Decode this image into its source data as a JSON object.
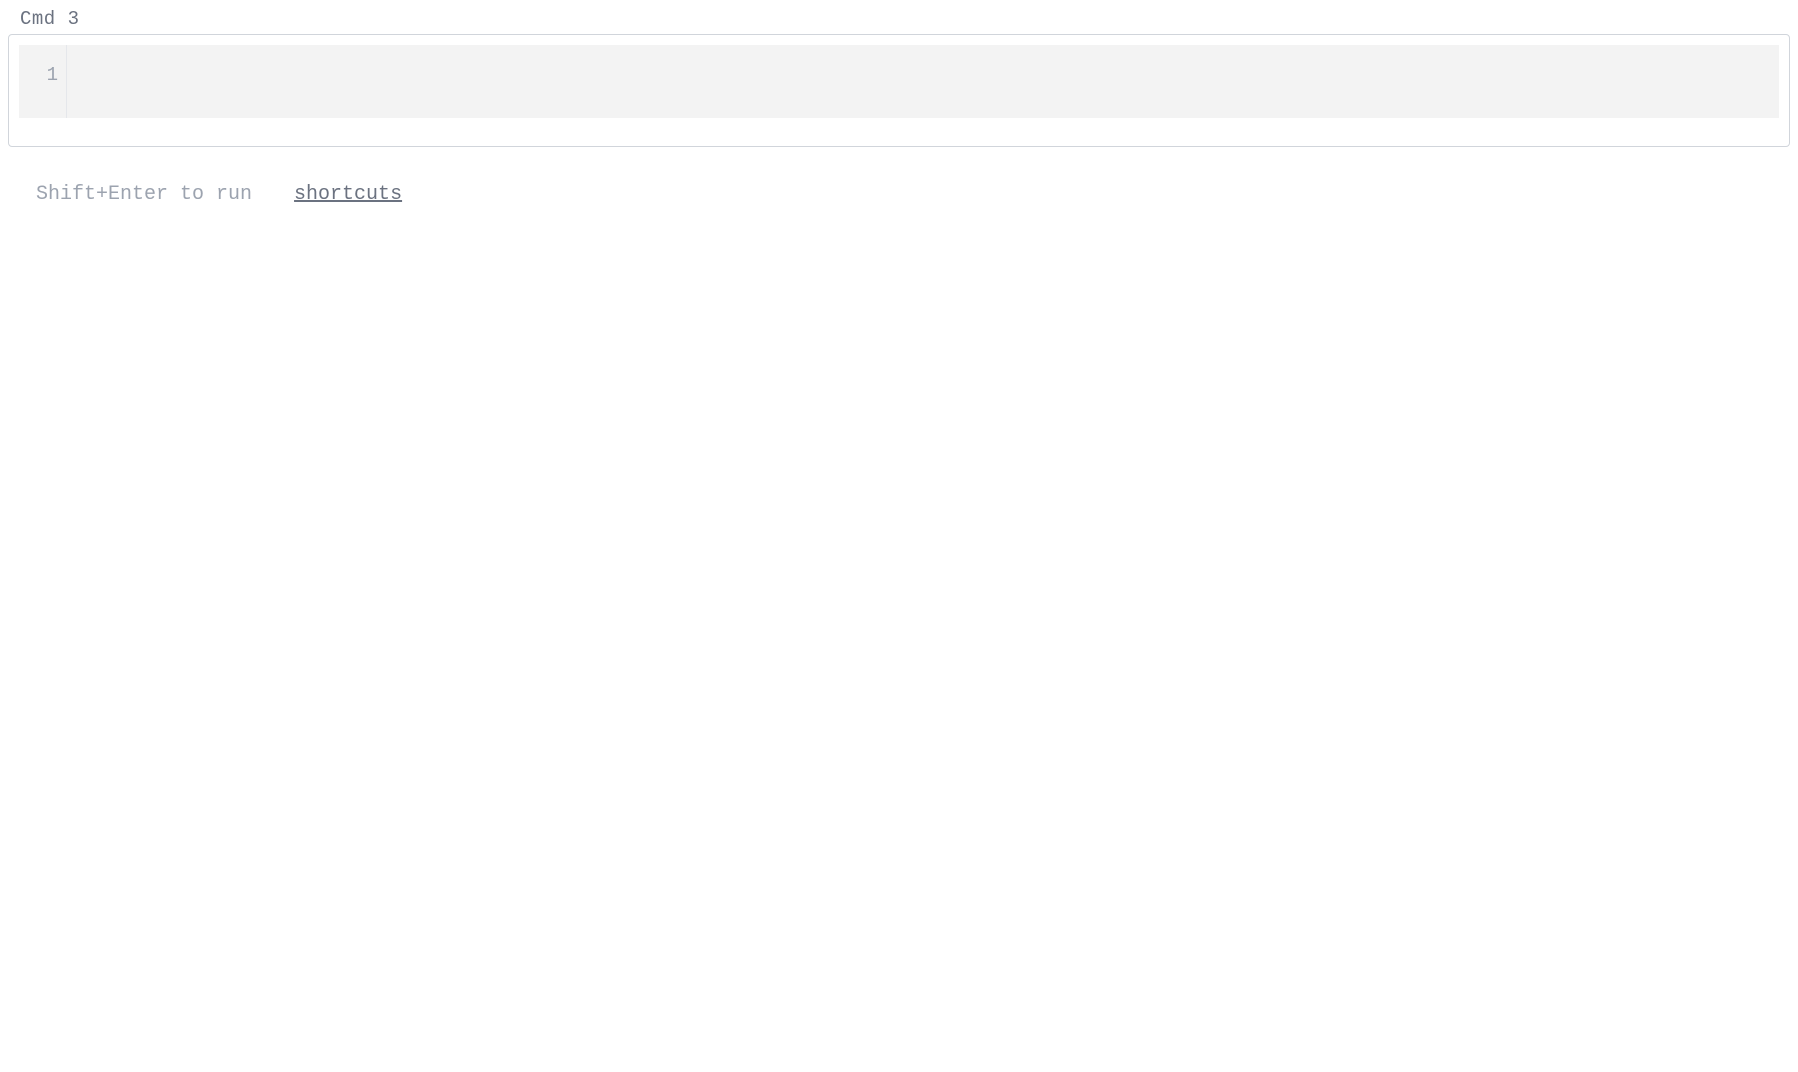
{
  "cell": {
    "label": "Cmd 3",
    "line_numbers": [
      "1"
    ],
    "code": ""
  },
  "hints": {
    "run_hint": "Shift+Enter to run",
    "shortcuts_label": "shortcuts"
  }
}
